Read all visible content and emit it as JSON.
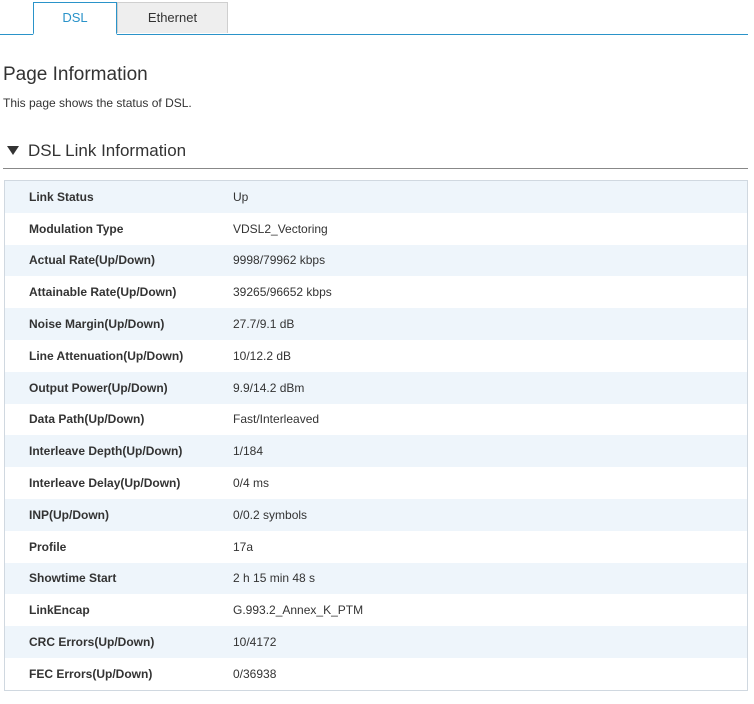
{
  "tabs": [
    {
      "label": "DSL",
      "active": true
    },
    {
      "label": "Ethernet",
      "active": false
    }
  ],
  "page": {
    "title": "Page Information",
    "description": "This page shows the status of DSL."
  },
  "section": {
    "title": "DSL Link Information",
    "expanded": true,
    "toggle_icon": "triangle-down-icon"
  },
  "rows": [
    {
      "label": "Link Status",
      "value": "Up"
    },
    {
      "label": "Modulation Type",
      "value": "VDSL2_Vectoring"
    },
    {
      "label": "Actual Rate(Up/Down)",
      "value": "9998/79962 kbps"
    },
    {
      "label": "Attainable Rate(Up/Down)",
      "value": "39265/96652 kbps"
    },
    {
      "label": "Noise Margin(Up/Down)",
      "value": "27.7/9.1 dB"
    },
    {
      "label": "Line Attenuation(Up/Down)",
      "value": "10/12.2 dB"
    },
    {
      "label": "Output Power(Up/Down)",
      "value": "9.9/14.2 dBm"
    },
    {
      "label": "Data Path(Up/Down)",
      "value": "Fast/Interleaved"
    },
    {
      "label": "Interleave Depth(Up/Down)",
      "value": "1/184"
    },
    {
      "label": "Interleave Delay(Up/Down)",
      "value": "0/4 ms"
    },
    {
      "label": "INP(Up/Down)",
      "value": "0/0.2 symbols"
    },
    {
      "label": "Profile",
      "value": "17a"
    },
    {
      "label": "Showtime Start",
      "value": "2 h 15 min 48 s"
    },
    {
      "label": "LinkEncap",
      "value": "G.993.2_Annex_K_PTM"
    },
    {
      "label": "CRC Errors(Up/Down)",
      "value": "10/4172"
    },
    {
      "label": "FEC Errors(Up/Down)",
      "value": "0/36938"
    }
  ],
  "colors": {
    "accent": "#2a93c9",
    "row_alt": "#eef5fb",
    "tab_inactive_bg": "#eeeeee"
  }
}
